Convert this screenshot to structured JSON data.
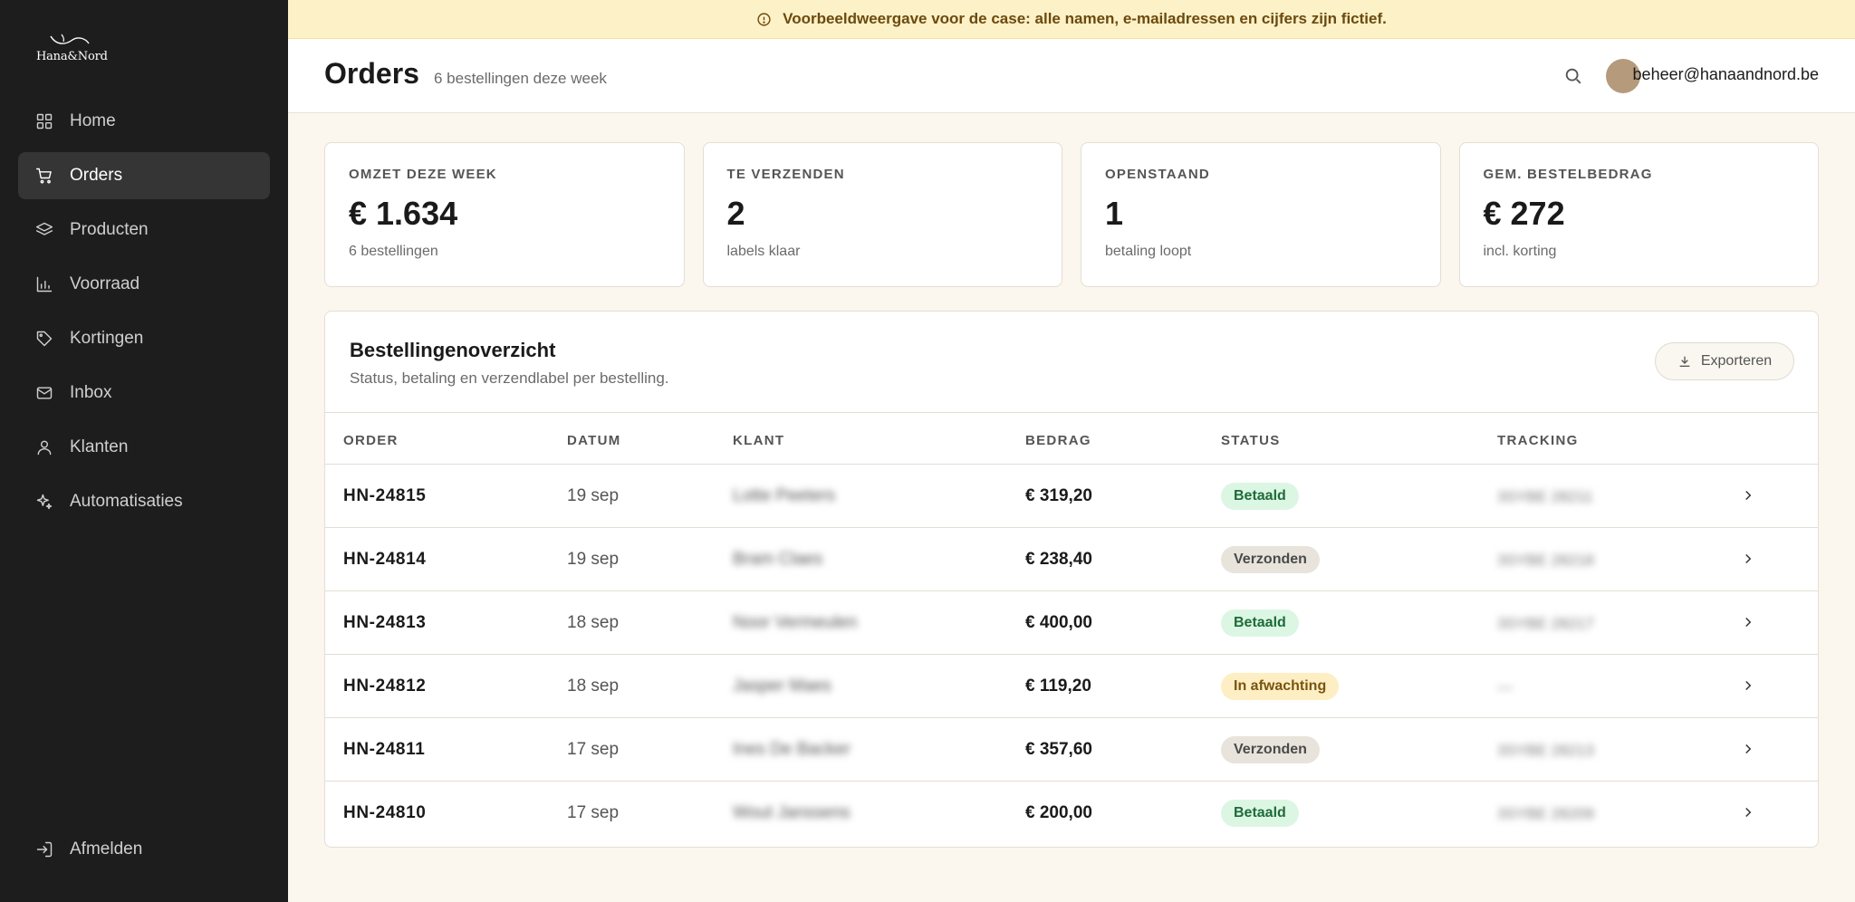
{
  "brand": {
    "logo_text": "Hana&Nord"
  },
  "sidebar": {
    "items": [
      {
        "label": "Home",
        "icon": "grid-icon",
        "active": false
      },
      {
        "label": "Orders",
        "icon": "cart-icon",
        "active": true
      },
      {
        "label": "Producten",
        "icon": "layers-icon",
        "active": false
      },
      {
        "label": "Voorraad",
        "icon": "bar-chart-icon",
        "active": false
      },
      {
        "label": "Kortingen",
        "icon": "tag-icon",
        "active": false
      },
      {
        "label": "Inbox",
        "icon": "mail-icon",
        "active": false
      },
      {
        "label": "Klanten",
        "icon": "user-icon",
        "active": false
      },
      {
        "label": "Automatisaties",
        "icon": "sparkle-icon",
        "active": false
      }
    ],
    "logout_label": "Afmelden"
  },
  "banner": {
    "text": "Voorbeeldweergave voor de case: alle namen, e-mailadressen en cijfers zijn fictief."
  },
  "header": {
    "title": "Orders",
    "subtitle": "6 bestellingen deze week",
    "user_email": "beheer@hanaandnord.be"
  },
  "stats": [
    {
      "label": "OMZET DEZE WEEK",
      "value": "€ 1.634",
      "sub": "6 bestellingen"
    },
    {
      "label": "TE VERZENDEN",
      "value": "2",
      "sub": "labels klaar"
    },
    {
      "label": "OPENSTAAND",
      "value": "1",
      "sub": "betaling loopt"
    },
    {
      "label": "GEM. BESTELBEDRAG",
      "value": "€ 272",
      "sub": "incl. korting"
    }
  ],
  "orders_panel": {
    "title": "Bestellingenoverzicht",
    "subtitle": "Status, betaling en verzendlabel per bestelling.",
    "export_label": "Exporteren",
    "columns": [
      "ORDER",
      "DATUM",
      "KLANT",
      "BEDRAG",
      "STATUS",
      "TRACKING"
    ],
    "rows": [
      {
        "order": "HN-24815",
        "date": "19 sep",
        "customer": "Lotte Peeters",
        "amount": "€ 319,20",
        "status": "Betaald",
        "status_kind": "paid",
        "tracking": "3SYBE 28211"
      },
      {
        "order": "HN-24814",
        "date": "19 sep",
        "customer": "Bram Claes",
        "amount": "€ 238,40",
        "status": "Verzonden",
        "status_kind": "shipped",
        "tracking": "3SYBE 28218"
      },
      {
        "order": "HN-24813",
        "date": "18 sep",
        "customer": "Noor Vermeulen",
        "amount": "€ 400,00",
        "status": "Betaald",
        "status_kind": "paid",
        "tracking": "3SYBE 28217"
      },
      {
        "order": "HN-24812",
        "date": "18 sep",
        "customer": "Jasper Maes",
        "amount": "€ 119,20",
        "status": "In afwachting",
        "status_kind": "pending",
        "tracking": "—"
      },
      {
        "order": "HN-24811",
        "date": "17 sep",
        "customer": "Ines De Backer",
        "amount": "€ 357,60",
        "status": "Verzonden",
        "status_kind": "shipped",
        "tracking": "3SYBE 28213"
      },
      {
        "order": "HN-24810",
        "date": "17 sep",
        "customer": "Wout Janssens",
        "amount": "€ 200,00",
        "status": "Betaald",
        "status_kind": "paid",
        "tracking": "3SYBE 28209"
      }
    ]
  }
}
